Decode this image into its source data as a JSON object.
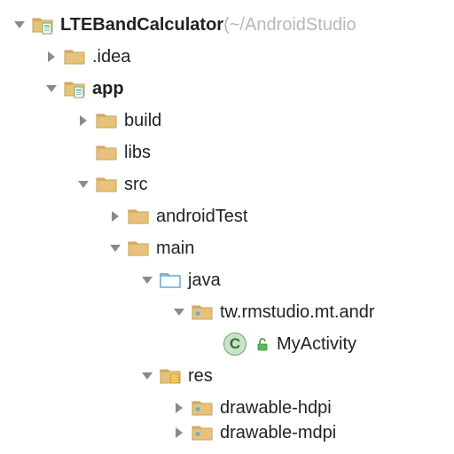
{
  "root": {
    "name": "LTEBandCalculator",
    "hint": " (~/AndroidStudio",
    "idea": ".idea",
    "app": "app",
    "build": "build",
    "libs": "libs",
    "src": "src",
    "androidTest": "androidTest",
    "main": "main",
    "java": "java",
    "pkg": "tw.rmstudio.mt.andr",
    "activity": "MyActivity",
    "classLetter": "C",
    "res": "res",
    "drawable_hdpi": "drawable-hdpi",
    "drawable_mdpi": "drawable-mdpi"
  }
}
